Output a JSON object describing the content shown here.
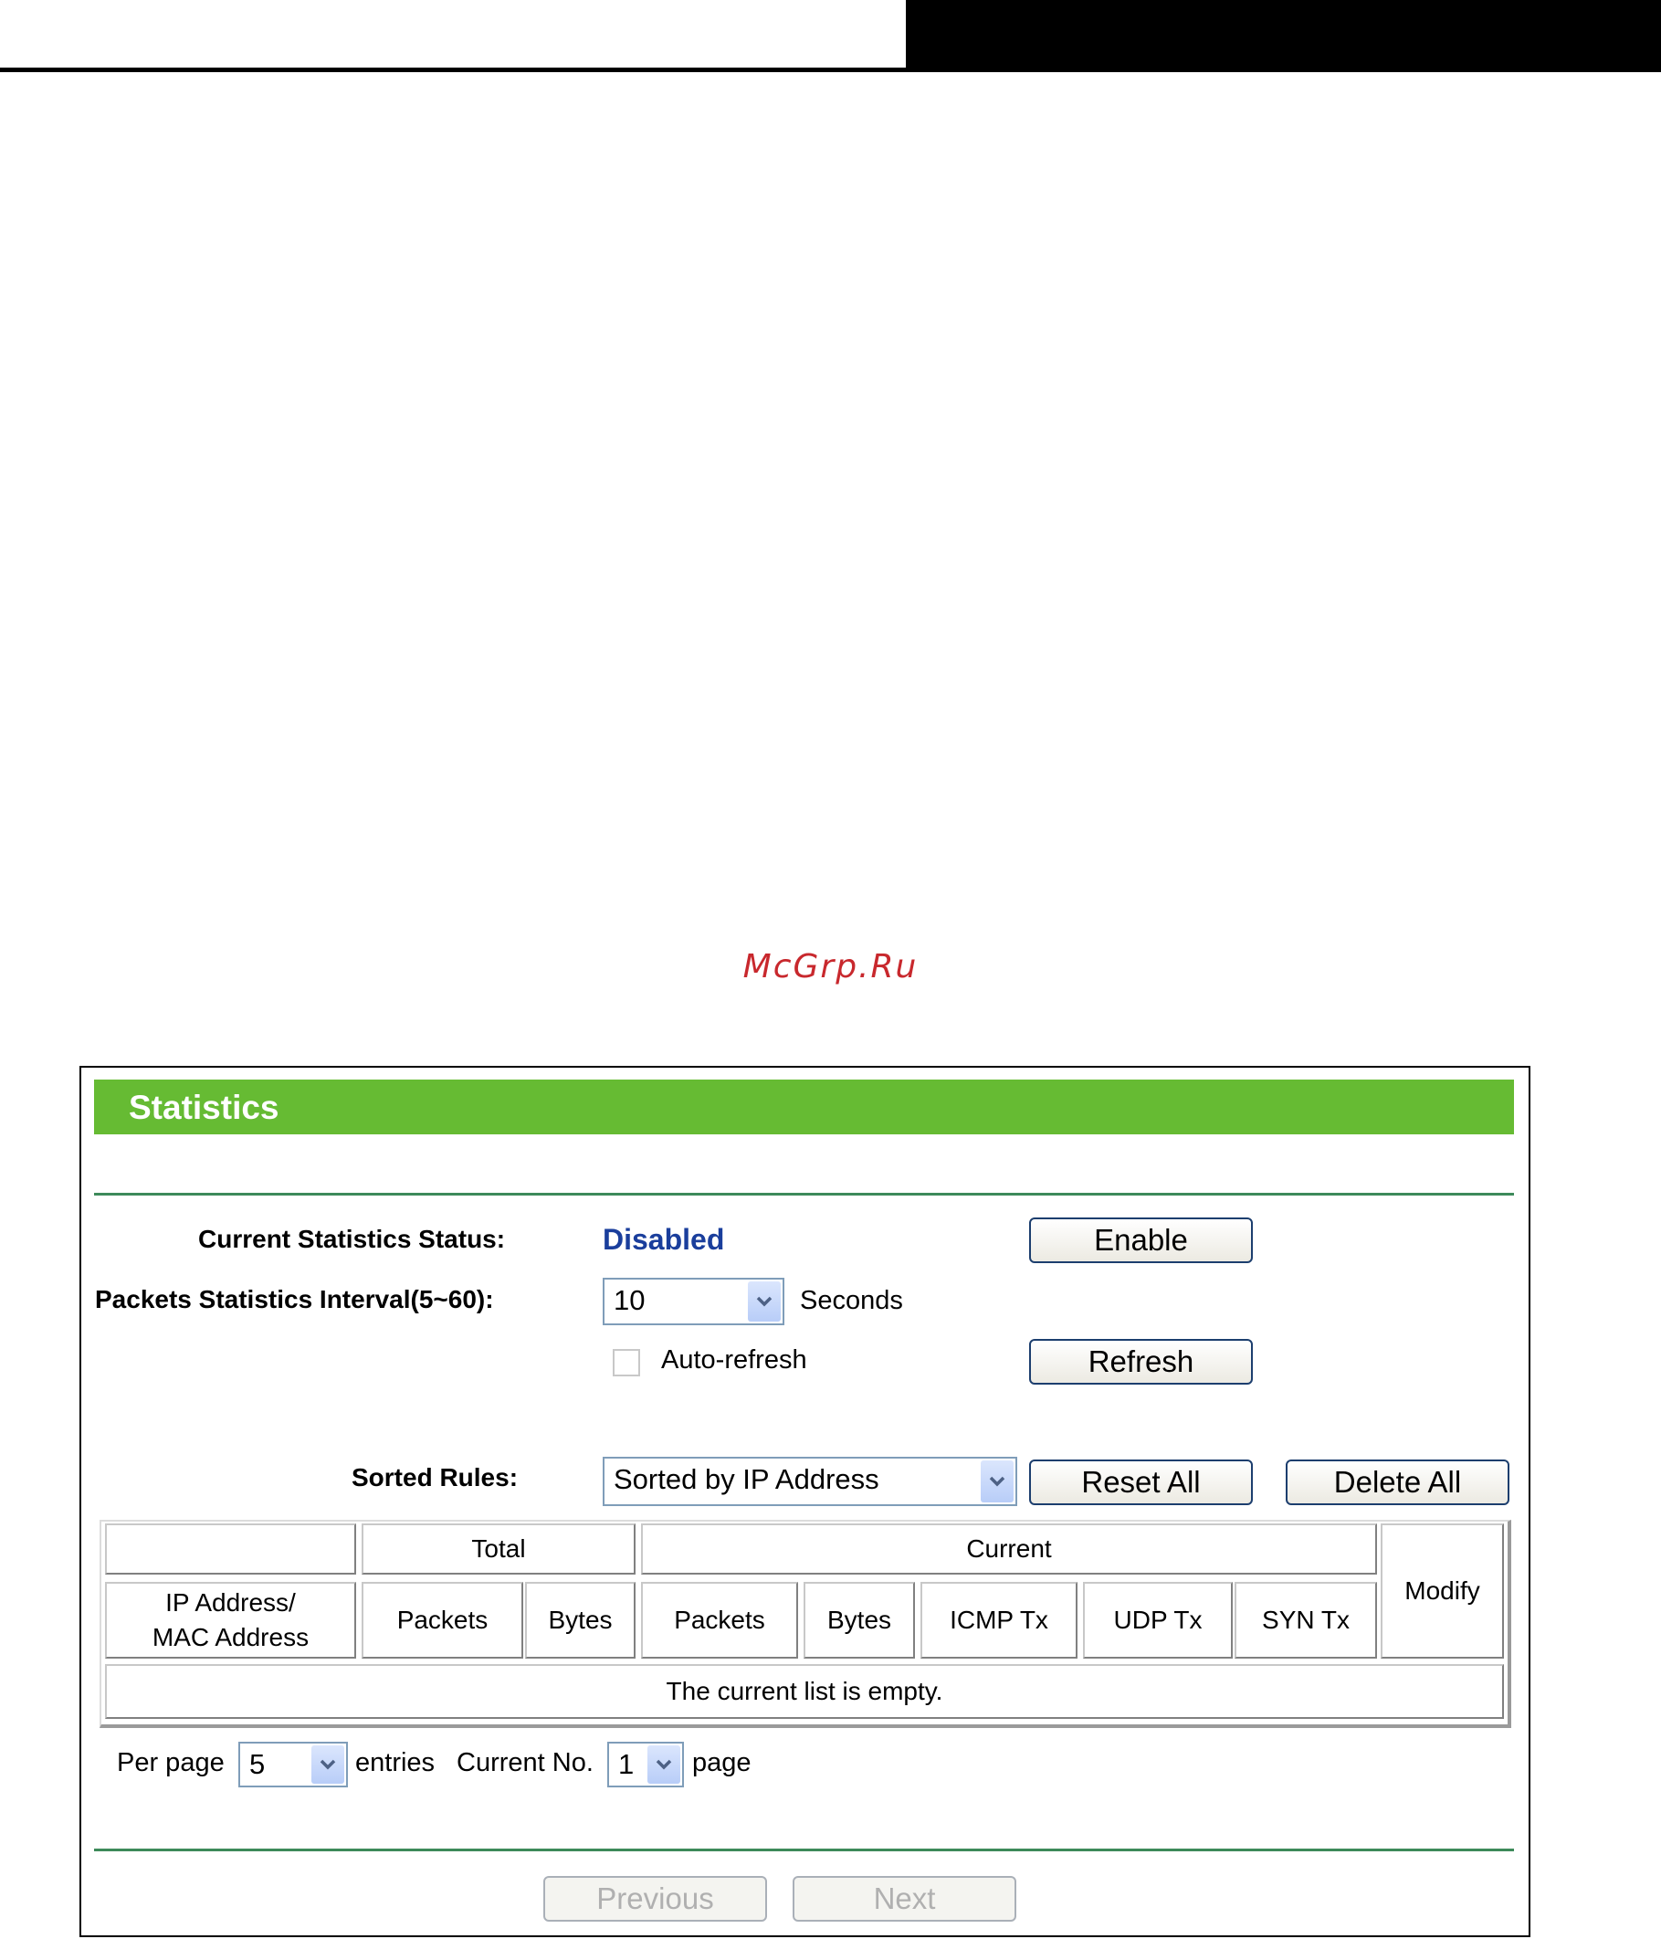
{
  "watermark": "McGrp.Ru",
  "panel": {
    "title": "Statistics",
    "status_label": "Current Statistics Status:",
    "status_value": "Disabled",
    "enable_label": "Enable",
    "interval_label": "Packets Statistics Interval(5~60):",
    "interval_value": "10",
    "interval_unit": "Seconds",
    "auto_refresh_label": "Auto-refresh",
    "auto_refresh_checked": false,
    "refresh_label": "Refresh",
    "sorted_rules_label": "Sorted Rules:",
    "sorted_rules_value": "Sorted by IP Address",
    "reset_all_label": "Reset All",
    "delete_all_label": "Delete All"
  },
  "table": {
    "group_total": "Total",
    "group_current": "Current",
    "modify": "Modify",
    "ip_mac_line1": "IP Address/",
    "ip_mac_line2": "MAC Address",
    "total_packets": "Packets",
    "total_bytes": "Bytes",
    "current_packets": "Packets",
    "current_bytes": "Bytes",
    "icmp_tx": "ICMP Tx",
    "udp_tx": "UDP Tx",
    "syn_tx": "SYN Tx",
    "empty_message": "The current list is empty."
  },
  "pagination": {
    "per_page_label": "Per page",
    "per_page_value": "5",
    "entries_label": "entries",
    "current_no_label": "Current No.",
    "current_no_value": "1",
    "page_label": "page",
    "previous_label": "Previous",
    "next_label": "Next"
  },
  "colors": {
    "title_bar": "#66bb33",
    "divider": "#3d8a5a",
    "status_value": "#1a3e9c",
    "watermark": "#c8282d"
  },
  "icons": {
    "dropdown": "chevron-down-icon"
  }
}
